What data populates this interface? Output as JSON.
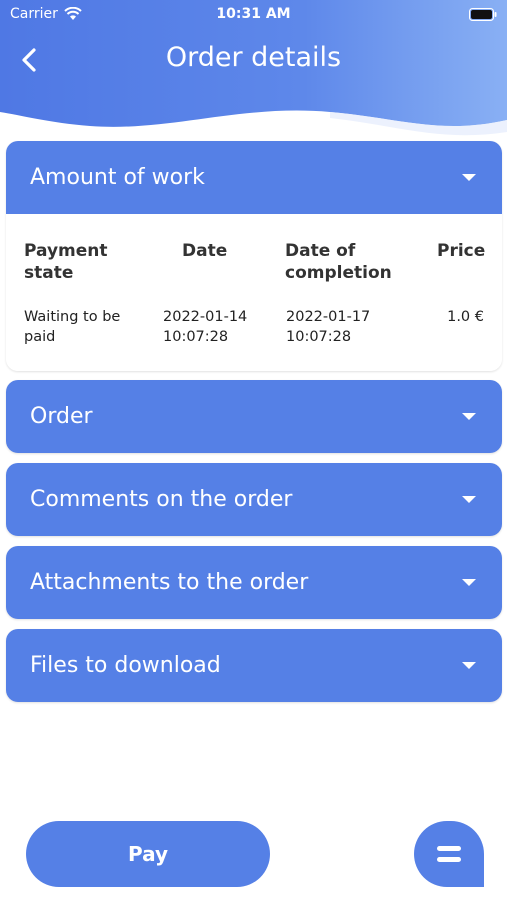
{
  "status_bar": {
    "carrier": "Carrier",
    "time": "10:31 AM",
    "icons": [
      "wifi-icon",
      "battery-icon"
    ]
  },
  "nav": {
    "title": "Order details",
    "back_icon": "chevron-left-icon"
  },
  "colors": {
    "accent": "#5580e6",
    "header_gradient_start": "#4f78e4",
    "header_gradient_end": "#89b0f4",
    "background": "#ffffff"
  },
  "sections": [
    {
      "label": "Amount of work",
      "expanded": true,
      "table": {
        "headers": [
          "Payment state",
          "Date",
          "Date of completion",
          "Price"
        ],
        "header_lines": [
          [
            "Payment",
            "state"
          ],
          [
            "Date"
          ],
          [
            "Date of",
            "completion"
          ],
          [
            "Price"
          ]
        ],
        "rows": [
          {
            "payment_state": [
              "Waiting to be",
              "paid"
            ],
            "date": [
              "2022-01-14",
              "10:07:28"
            ],
            "completion": [
              "2022-01-17",
              "10:07:28"
            ],
            "price": "1.0 €"
          }
        ]
      }
    },
    {
      "label": "Order",
      "expanded": false
    },
    {
      "label": "Comments on the order",
      "expanded": false
    },
    {
      "label": "Attachments to the order",
      "expanded": false
    },
    {
      "label": "Files to download",
      "expanded": false
    }
  ],
  "actions": {
    "pay_label": "Pay",
    "chat_icon": "chat-icon"
  }
}
